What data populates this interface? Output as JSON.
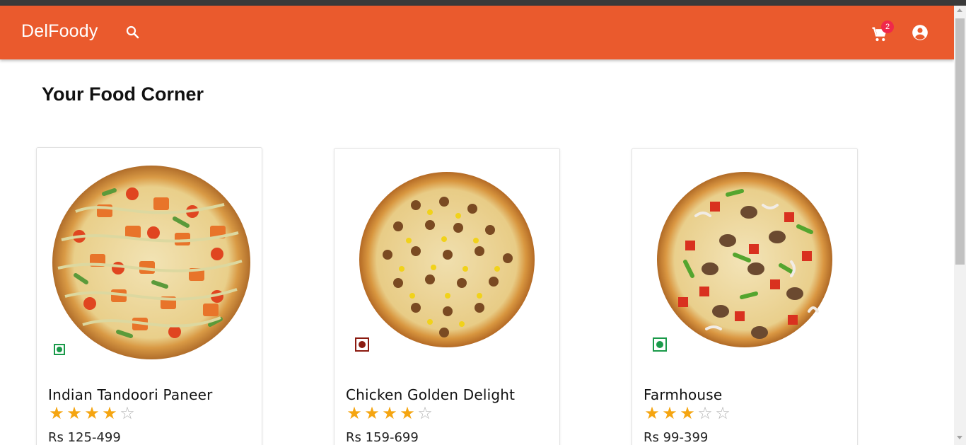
{
  "app": {
    "brand": "DelFoody",
    "cart_count": "2",
    "icons": {
      "search": "search-icon",
      "cart": "cart-icon",
      "account": "account-circle-icon"
    },
    "colors": {
      "appbar": "#ea5a2d",
      "badge": "#f0284a",
      "star": "#f5a511",
      "veg": "#1a9a4a",
      "nonveg": "#8b1a10"
    }
  },
  "page": {
    "title": "Your Food Corner"
  },
  "products": [
    {
      "name": "Indian Tandoori Paneer",
      "rating": 4,
      "rating_max": 5,
      "price": "Rs 125-499",
      "type": "veg"
    },
    {
      "name": "Chicken Golden Delight",
      "rating": 4,
      "rating_max": 5,
      "price": "Rs 159-699",
      "type": "non-veg"
    },
    {
      "name": "Farmhouse",
      "rating": 3,
      "rating_max": 5,
      "price": "Rs 99-399",
      "type": "veg"
    }
  ]
}
